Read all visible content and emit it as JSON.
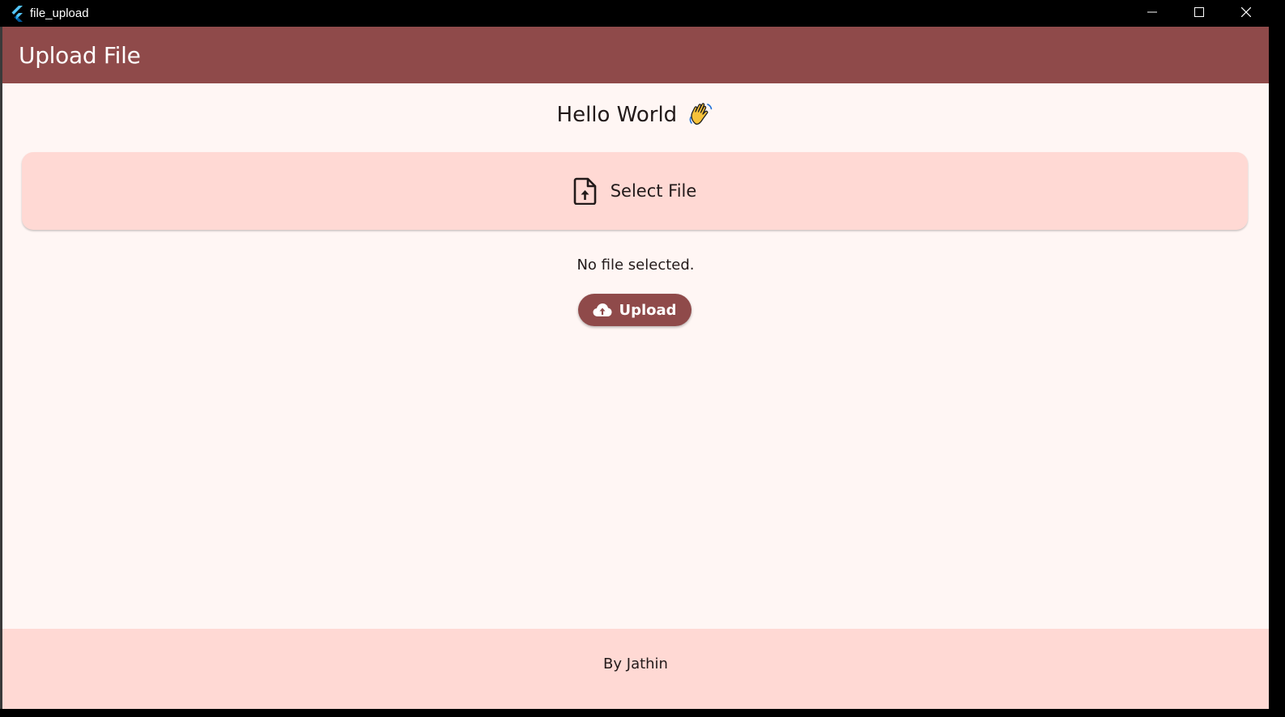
{
  "window": {
    "title": "file_upload",
    "controls": [
      "minimize-icon",
      "maximize-icon",
      "close-icon"
    ]
  },
  "appbar": {
    "title": "Upload File",
    "color": "#8f4a4a"
  },
  "main": {
    "greeting": "Hello World",
    "greeting_emoji": "waving-hand-icon",
    "select_file": {
      "label": "Select File",
      "icon": "file-upload-icon"
    },
    "status": "No file selected.",
    "upload_button": {
      "label": "Upload",
      "icon": "cloud-upload-icon"
    }
  },
  "footer": {
    "text": "By Jathin"
  },
  "colors": {
    "primary": "#8f4a4a",
    "surface": "#fff6f4",
    "container": "#ffd9d4",
    "on_surface": "#221a1a"
  }
}
